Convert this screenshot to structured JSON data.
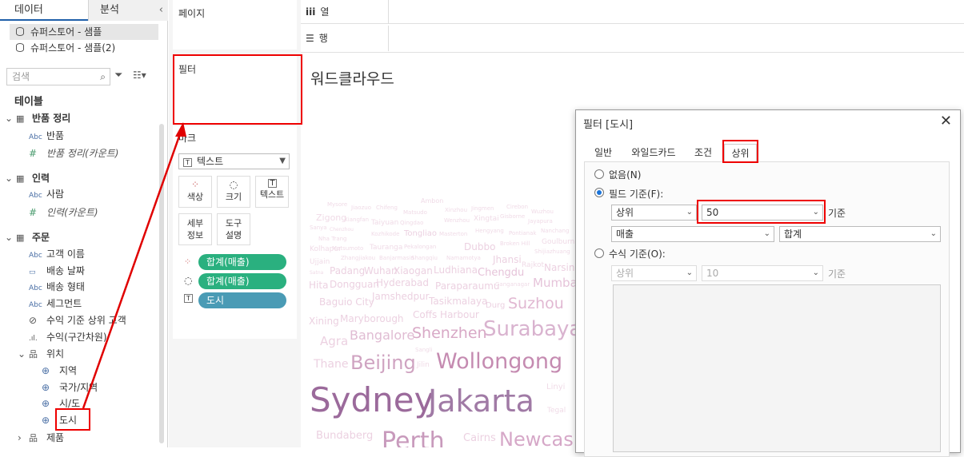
{
  "data_pane": {
    "tab_data": "데이터",
    "tab_analysis": "분석",
    "collapse_icon": "chevron-left-icon",
    "datasources": [
      "슈퍼스토어 - 샘플",
      "슈퍼스토어 - 샘플(2)"
    ],
    "search_placeholder": "검색",
    "tables_label": "테이블",
    "groups": [
      {
        "name": "반품 정리",
        "fields": [
          {
            "icon": "Abc",
            "label": "반품"
          },
          {
            "icon": "#",
            "label": "반품 정리(카운트)"
          }
        ]
      },
      {
        "name": "인력",
        "fields": [
          {
            "icon": "Abc",
            "label": "사람"
          },
          {
            "icon": "#",
            "label": "인력(카운트)"
          }
        ]
      },
      {
        "name": "주문",
        "fields": [
          {
            "icon": "Abc",
            "label": "고객 이름"
          },
          {
            "icon": "date",
            "label": "배송 날짜"
          },
          {
            "icon": "Abc",
            "label": "배송 형태"
          },
          {
            "icon": "Abc",
            "label": "세그먼트"
          },
          {
            "icon": "set",
            "label": "수익 기준 상위 고객"
          },
          {
            "icon": "bins",
            "label": "수익(구간차원)"
          },
          {
            "icon": "hierarchy",
            "label": "위치"
          },
          {
            "icon": "globe",
            "label": "지역"
          },
          {
            "icon": "globe",
            "label": "국가/지역"
          },
          {
            "icon": "globe",
            "label": "시/도"
          },
          {
            "icon": "globe",
            "label": "도시"
          },
          {
            "icon": "hierarchy",
            "label": "제품"
          }
        ]
      }
    ]
  },
  "shelves": {
    "pages": "페이지",
    "filters": "필터",
    "marks": "마크",
    "mark_type": "텍스트",
    "columns": "열",
    "rows": "행",
    "mark_buttons": [
      "색상",
      "크기",
      "텍스트",
      "세부\n정보",
      "도구\n설명"
    ],
    "pills": [
      "합계(매출)",
      "합계(매출)",
      "도시"
    ]
  },
  "view": {
    "title": "워드클라우드",
    "words": [
      {
        "t": "Sydney",
        "c": "#9b6a9b"
      },
      {
        "t": "Jakarta",
        "c": "#a07aa5"
      },
      {
        "t": "Wollongong",
        "c": "#c58bb1"
      },
      {
        "t": "Beijing",
        "c": "#cfa3c1"
      },
      {
        "t": "Surabaya",
        "c": "#d9b3cf"
      },
      {
        "t": "Shenzhen",
        "c": "#d8a9c6"
      },
      {
        "t": "Bangalore",
        "c": "#e0bcd3"
      },
      {
        "t": "Perth",
        "c": "#c89abc"
      },
      {
        "t": "Newcas",
        "c": "#d6a8c8"
      },
      {
        "t": "Suzhou",
        "c": "#e1b8d2"
      },
      {
        "t": "Mumbai",
        "c": "#e6c4da"
      },
      {
        "t": "Agra",
        "c": "#ecd1e1"
      },
      {
        "t": "Thane",
        "c": "#ecd1e1"
      },
      {
        "t": "Jilin",
        "c": "#f0dbe7"
      },
      {
        "t": "Coffs Harbour",
        "c": "#ecd1e1"
      },
      {
        "t": "Maryborough",
        "c": "#ecd1e1"
      },
      {
        "t": "Xining",
        "c": "#ecd1e1"
      },
      {
        "t": "Tasikmalaya",
        "c": "#ecd1e1"
      },
      {
        "t": "Baguio City",
        "c": "#ecd1e1"
      },
      {
        "t": "Jamshedpur",
        "c": "#ecd1e1"
      },
      {
        "t": "Paraparaumu",
        "c": "#ecd1e1"
      },
      {
        "t": "Hyderabad",
        "c": "#ecd1e1"
      },
      {
        "t": "Hita",
        "c": "#ecd1e1"
      },
      {
        "t": "Dongguan",
        "c": "#ecd1e1"
      },
      {
        "t": "Padang",
        "c": "#ecd1e1"
      },
      {
        "t": "Wuhan",
        "c": "#ecd1e1"
      },
      {
        "t": "Xiaogan",
        "c": "#ecd1e1"
      },
      {
        "t": "Ludhiana",
        "c": "#ecd1e1"
      },
      {
        "t": "Chengdu",
        "c": "#e6c4da"
      },
      {
        "t": "Jhansi",
        "c": "#ecd1e1"
      },
      {
        "t": "Narsin",
        "c": "#ecd1e1"
      },
      {
        "t": "Dubbo",
        "c": "#ecd1e1"
      },
      {
        "t": "Tongliao",
        "c": "#ecd1e1"
      },
      {
        "t": "Zigong",
        "c": "#f0dbe7"
      },
      {
        "t": "Bundaberg",
        "c": "#ecd1e1"
      },
      {
        "t": "Cairns",
        "c": "#ecd1e1"
      },
      {
        "t": "Durg",
        "c": "#ecd1e1"
      },
      {
        "t": "Ujjain",
        "c": "#f0dbe7"
      },
      {
        "t": "Kolhapur",
        "c": "#f0dbe7"
      },
      {
        "t": "Ambon",
        "c": "#f0dbe7"
      },
      {
        "t": "Mysore",
        "c": "#f0dbe7"
      },
      {
        "t": "Jiaozuo",
        "c": "#f0dbe7"
      },
      {
        "t": "Chifeng",
        "c": "#f0dbe7"
      },
      {
        "t": "Matsudo",
        "c": "#f0dbe7"
      },
      {
        "t": "Xinzhou",
        "c": "#f0dbe7"
      },
      {
        "t": "Jingmen",
        "c": "#f0dbe7"
      },
      {
        "t": "Cirebon",
        "c": "#f0dbe7"
      },
      {
        "t": "Wuzhou",
        "c": "#f0dbe7"
      },
      {
        "t": "Xiangfan",
        "c": "#f0dbe7"
      },
      {
        "t": "Taiyuan",
        "c": "#f0dbe7"
      },
      {
        "t": "Qingdao",
        "c": "#f0dbe7"
      },
      {
        "t": "Wenzhou",
        "c": "#f0dbe7"
      },
      {
        "t": "Xingtai",
        "c": "#f0dbe7"
      },
      {
        "t": "Gisborne",
        "c": "#f0dbe7"
      },
      {
        "t": "Jayapura",
        "c": "#f0dbe7"
      },
      {
        "t": "Sanya",
        "c": "#f0dbe7"
      },
      {
        "t": "Chenzhou",
        "c": "#f0dbe7"
      },
      {
        "t": "Kozhikode",
        "c": "#f0dbe7"
      },
      {
        "t": "Masterton",
        "c": "#f0dbe7"
      },
      {
        "t": "Hengyang",
        "c": "#f0dbe7"
      },
      {
        "t": "Pontianak",
        "c": "#f0dbe7"
      },
      {
        "t": "Nanchang",
        "c": "#f0dbe7"
      },
      {
        "t": "Nha Trang",
        "c": "#f0dbe7"
      },
      {
        "t": "Broken Hill",
        "c": "#f0dbe7"
      },
      {
        "t": "Goulburn",
        "c": "#f0dbe7"
      },
      {
        "t": "Matsumoto",
        "c": "#f0dbe7"
      },
      {
        "t": "Tauranga",
        "c": "#f0dbe7"
      },
      {
        "t": "Pekalongan",
        "c": "#f0dbe7"
      },
      {
        "t": "Shijiazhuang",
        "c": "#f0dbe7"
      },
      {
        "t": "Zhangjiakou",
        "c": "#f0dbe7"
      },
      {
        "t": "Banjarmasin",
        "c": "#f0dbe7"
      },
      {
        "t": "Shangqiu",
        "c": "#f0dbe7"
      },
      {
        "t": "Namamotya",
        "c": "#f0dbe7"
      },
      {
        "t": "Rajkot",
        "c": "#f0dbe7"
      },
      {
        "t": "Satna",
        "c": "#f0dbe7"
      },
      {
        "t": "Ganganagar",
        "c": "#f0dbe7"
      },
      {
        "t": "Sangli",
        "c": "#f0dbe7"
      },
      {
        "t": "Linyi",
        "c": "#f0dbe7"
      },
      {
        "t": "Tegal",
        "c": "#f0dbe7"
      }
    ]
  },
  "dialog": {
    "title": "필터 [도시]",
    "close_icon": "close-icon",
    "tabs": [
      "일반",
      "와일드카드",
      "조건",
      "상위"
    ],
    "none_option": "없음(N)",
    "by_field_option": "필드 기준(F):",
    "top_select": "상위",
    "count_value": "50",
    "basis_label": "기준",
    "field_select": "매출",
    "agg_select": "합계",
    "by_formula_option": "수식 기준(O):",
    "formula_top_select": "상위",
    "formula_count": "10",
    "formula_basis_label": "기준"
  },
  "colors": {
    "pill_green": "#2ab07f",
    "pill_blue": "#4a9bb5",
    "highlight_red": "#e00000",
    "radio_blue": "#1a73d9"
  }
}
